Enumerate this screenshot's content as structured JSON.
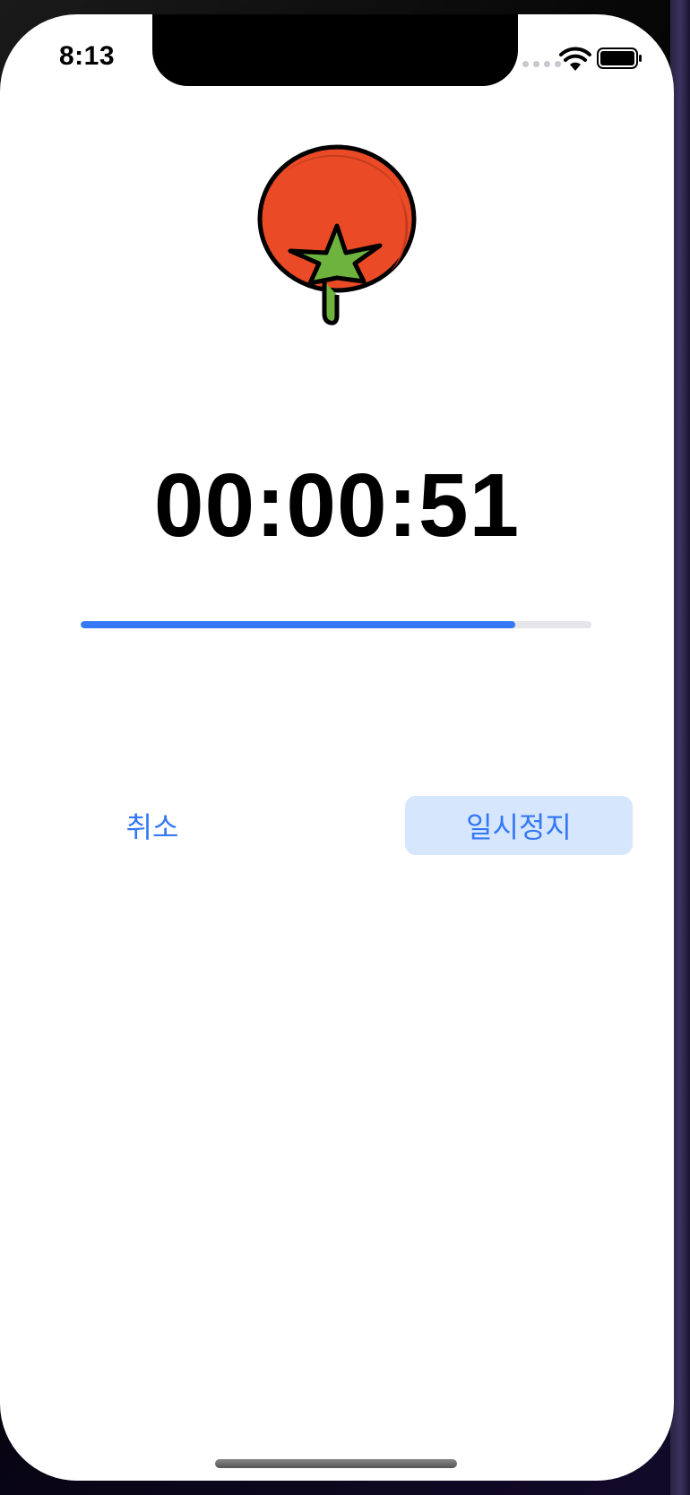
{
  "status_bar": {
    "time": "8:13",
    "icons": [
      "cellular-signal-icon",
      "wifi-icon",
      "battery-icon"
    ]
  },
  "app": {
    "icon": "tomato-icon",
    "timer_text": "00:00:51",
    "progress_fraction": 0.85,
    "accent_color": "#3478f6"
  },
  "buttons": {
    "cancel_label": "취소",
    "pause_label": "일시정지"
  }
}
